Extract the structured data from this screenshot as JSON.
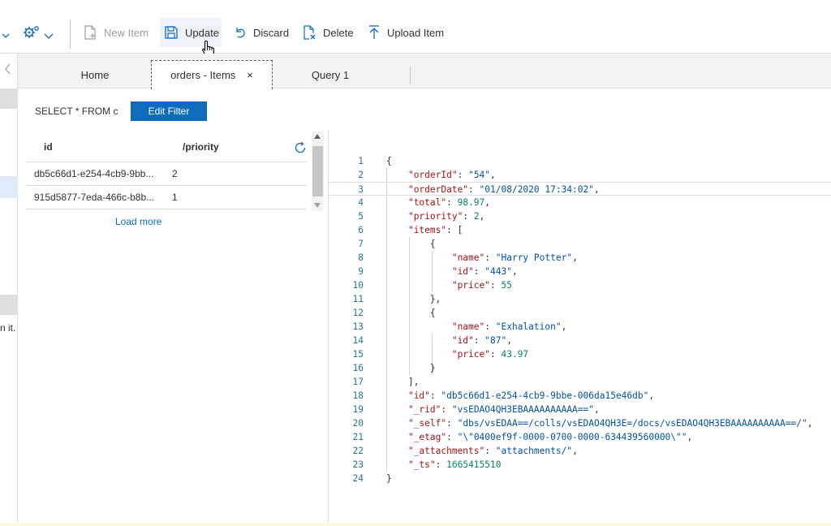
{
  "toolbar": {
    "new_item_label": "New Item",
    "update_label": "Update",
    "discard_label": "Discard",
    "delete_label": "Delete",
    "upload_item_label": "Upload Item"
  },
  "sidebar": {
    "clipped_text": "n it."
  },
  "tabs": [
    {
      "label": "Home"
    },
    {
      "label": "orders - Items",
      "close": "×"
    },
    {
      "label": "Query 1"
    }
  ],
  "filter": {
    "query_text": "SELECT * FROM c",
    "edit_filter_label": "Edit Filter"
  },
  "grid": {
    "columns": [
      "id",
      "/priority"
    ],
    "rows": [
      {
        "id": "db5c66d1-e254-4cb9-9bb...",
        "priority": "2"
      },
      {
        "id": "915d5877-7eda-466c-b8b...",
        "priority": "1"
      }
    ],
    "load_more_label": "Load more"
  },
  "editor": {
    "line_numbers": [
      "1",
      "2",
      "3",
      "4",
      "5",
      "6",
      "7",
      "8",
      "9",
      "10",
      "11",
      "12",
      "13",
      "14",
      "15",
      "16",
      "17",
      "18",
      "19",
      "20",
      "21",
      "22",
      "23",
      "24"
    ],
    "current_line": 3,
    "json": {
      "orderId": "54",
      "orderDate": "01/08/2020 17:34:02",
      "total": "98.97",
      "priority": "2",
      "items": [
        {
          "name": "Harry Potter",
          "id": "443",
          "price": "55"
        },
        {
          "name": "Exhalation",
          "id": "87",
          "price": "43.97"
        }
      ],
      "id": "db5c66d1-e254-4cb9-9bbe-006da15e46db",
      "_rid": "vsEDAO4QH3EBAAAAAAAAAA==",
      "_self": "dbs/vsEDAA==/colls/vsEDAO4QH3E=/docs/vsEDAO4QH3EBAAAAAAAAAA==/",
      "_etag": "\\\"0400ef9f-0000-0700-0000-634439560000\\\"",
      "_attachments": "attachments/",
      "_ts": "1665415510"
    }
  },
  "colors": {
    "accent": "#0f6cbd",
    "key": "#a31515",
    "string": "#0451a5",
    "number": "#098658",
    "line_number": "#237893"
  },
  "icons": [
    "chevron-down-icon",
    "settings-gear-icon",
    "new-item-icon",
    "save-icon",
    "undo-icon",
    "delete-icon",
    "upload-icon",
    "refresh-icon",
    "close-icon",
    "chevron-left-icon"
  ]
}
